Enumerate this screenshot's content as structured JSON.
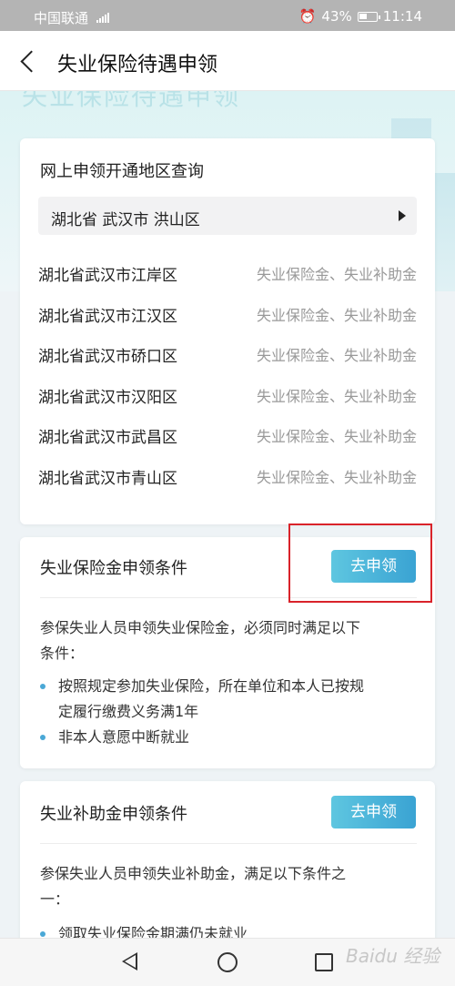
{
  "status_bar": {
    "carrier": "中国联通",
    "network": "4G",
    "battery": "43%",
    "time": "11:14"
  },
  "header": {
    "title": "失业保险待遇申领"
  },
  "hero": {
    "banner_text": "失业保险待遇申领"
  },
  "region_query": {
    "title": "网上申领开通地区查询",
    "selected": "湖北省 武汉市 洪山区",
    "regions": [
      {
        "name": "湖北省武汉市江岸区",
        "services": "失业保险金、失业补助金"
      },
      {
        "name": "湖北省武汉市江汉区",
        "services": "失业保险金、失业补助金"
      },
      {
        "name": "湖北省武汉市硚口区",
        "services": "失业保险金、失业补助金"
      },
      {
        "name": "湖北省武汉市汉阳区",
        "services": "失业保险金、失业补助金"
      },
      {
        "name": "湖北省武汉市武昌区",
        "services": "失业保险金、失业补助金"
      },
      {
        "name": "湖北省武汉市青山区",
        "services": "失业保险金、失业补助金"
      }
    ]
  },
  "insurance_section": {
    "title": "失业保险金申领条件",
    "apply_label": "去申领",
    "desc_line1": "参保失业人员申领失业保险金，必须同时满足以下",
    "desc_line2": "条件：",
    "bullets": [
      {
        "line1": "按照规定参加失业保险，所在单位和本人已按规",
        "line2": "定履行缴费义务满1年"
      },
      {
        "line1": "非本人意愿中断就业",
        "line2": ""
      }
    ]
  },
  "subsidy_section": {
    "title": "失业补助金申领条件",
    "apply_label": "去申领",
    "desc_line1": "参保失业人员申领失业补助金，满足以下条件之",
    "desc_line2": "一：",
    "bullets": [
      {
        "line1": "领取失业保险金期满仍未就业"
      }
    ]
  },
  "colors": {
    "accent": "#3aa3d3",
    "highlight_box": "#d9232a"
  },
  "watermark": "Baidu 经验"
}
